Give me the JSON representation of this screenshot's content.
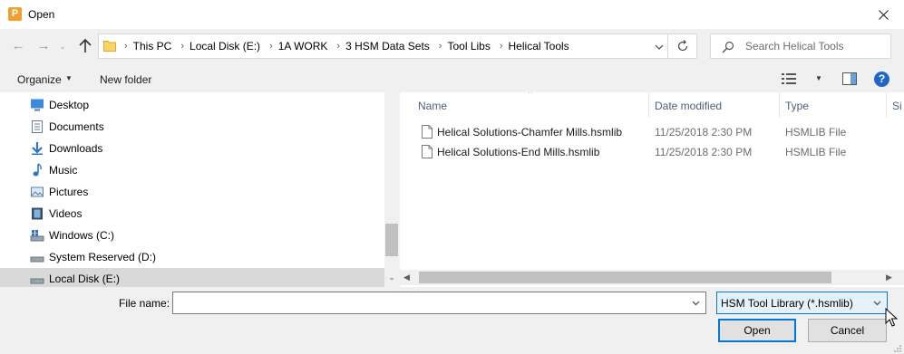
{
  "window": {
    "title": "Open",
    "app_icon_letter": "P",
    "app_icon_color": "#f0a030"
  },
  "navigation": {
    "breadcrumbs": [
      "This PC",
      "Local Disk (E:)",
      "1A WORK",
      "3 HSM Data Sets",
      "Tool Libs",
      "Helical Tools"
    ],
    "search_placeholder": "Search Helical Tools"
  },
  "commandbar": {
    "organize_label": "Organize",
    "new_folder_label": "New folder",
    "help_label": "?"
  },
  "sidebar": {
    "items": [
      {
        "label": "Desktop",
        "icon": "desktop-icon"
      },
      {
        "label": "Documents",
        "icon": "documents-icon"
      },
      {
        "label": "Downloads",
        "icon": "downloads-icon"
      },
      {
        "label": "Music",
        "icon": "music-icon"
      },
      {
        "label": "Pictures",
        "icon": "pictures-icon"
      },
      {
        "label": "Videos",
        "icon": "videos-icon"
      },
      {
        "label": "Windows (C:)",
        "icon": "drive-windows-icon"
      },
      {
        "label": "System Reserved (D:)",
        "icon": "drive-icon"
      },
      {
        "label": "Local Disk (E:)",
        "icon": "drive-icon",
        "selected": true
      }
    ]
  },
  "filelist": {
    "columns": [
      "Name",
      "Date modified",
      "Type",
      "Si"
    ],
    "files": [
      {
        "name": "Helical Solutions-Chamfer Mills.hsmlib",
        "date": "11/25/2018 2:30 PM",
        "type": "HSMLIB File"
      },
      {
        "name": "Helical Solutions-End Mills.hsmlib",
        "date": "11/25/2018 2:30 PM",
        "type": "HSMLIB File"
      }
    ]
  },
  "footer": {
    "file_name_label": "File name:",
    "file_name_value": "",
    "filter_value": "HSM Tool Library (*.hsmlib)",
    "open_label": "Open",
    "cancel_label": "Cancel"
  },
  "colors": {
    "accent": "#0078d7",
    "selection": "#d9d9d9",
    "header_text": "#4c607a"
  }
}
